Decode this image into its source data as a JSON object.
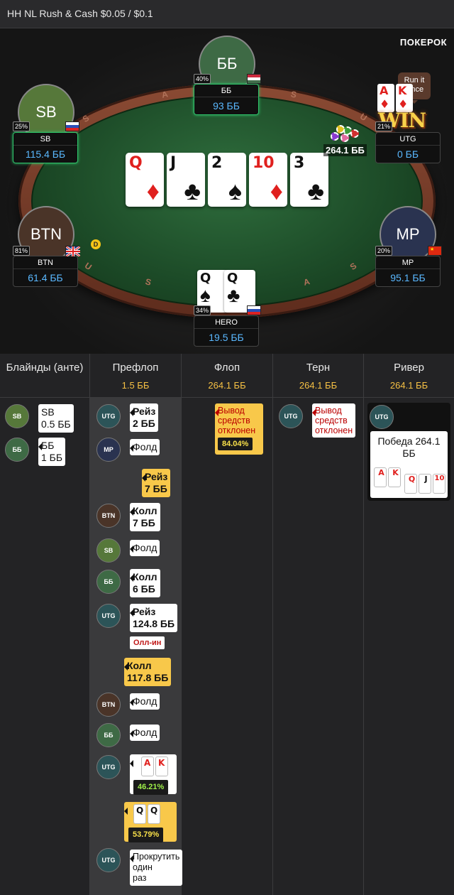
{
  "header": {
    "title": "HH NL Rush & Cash $0.05 / $0.1"
  },
  "brand": {
    "logo": "ПОКЕРОК",
    "run_it_once": "Run it Once"
  },
  "rail_letters": [
    "S",
    "A",
    "S",
    "U",
    "U",
    "S",
    "A",
    "S"
  ],
  "board": [
    {
      "rank": "Q",
      "suit": "♦",
      "color": "red"
    },
    {
      "rank": "J",
      "suit": "♣",
      "color": "black"
    },
    {
      "rank": "2",
      "suit": "♠",
      "color": "black"
    },
    {
      "rank": "10",
      "suit": "♦",
      "color": "red"
    },
    {
      "rank": "3",
      "suit": "♣",
      "color": "black"
    }
  ],
  "pot": "264.1 ББ",
  "dealer_button": "D",
  "win_text": "WIN",
  "seats": {
    "bb": {
      "avatar": "ББ",
      "name": "ББ",
      "stack": "93 ББ",
      "pct": "40%",
      "flag": "hungary",
      "avatar_color": "#3e6a45"
    },
    "sb": {
      "avatar": "SB",
      "name": "SB",
      "stack": "115.4 ББ",
      "pct": "25%",
      "flag": "russia",
      "avatar_color": "#56783a"
    },
    "utg": {
      "name": "UTG",
      "stack": "0 ББ",
      "pct": "21%",
      "cards": [
        {
          "rank": "A",
          "suit": "♦"
        },
        {
          "rank": "K",
          "suit": "♦"
        }
      ]
    },
    "btn": {
      "avatar": "BTN",
      "name": "BTN",
      "stack": "61.4 ББ",
      "pct": "81%",
      "flag": "uk",
      "avatar_color": "#4a3428"
    },
    "mp": {
      "avatar": "MP",
      "name": "MP",
      "stack": "95.1 ББ",
      "pct": "20%",
      "flag": "china",
      "avatar_color": "#2a3350"
    },
    "hero": {
      "name": "HERO",
      "stack": "19.5 ББ",
      "pct": "34%",
      "flag": "russia",
      "cards": [
        {
          "rank": "Q",
          "suit": "♠"
        },
        {
          "rank": "Q",
          "suit": "♣"
        }
      ]
    }
  },
  "history": {
    "columns": [
      {
        "name": "Блайнды (анте)",
        "pot": ""
      },
      {
        "name": "Префлоп",
        "pot": "1.5 ББ"
      },
      {
        "name": "Флоп",
        "pot": "264.1 ББ"
      },
      {
        "name": "Терн",
        "pot": "264.1 ББ"
      },
      {
        "name": "Ривер",
        "pot": "264.1 ББ"
      }
    ],
    "blinds": [
      {
        "pos": "SB",
        "line1": "SB",
        "line2": "0.5 ББ"
      },
      {
        "pos": "ББ",
        "line1": "ББ",
        "line2": "1 ББ"
      }
    ],
    "preflop": [
      {
        "pos": "UTG",
        "line1": "Рейз",
        "line2": "2 ББ"
      },
      {
        "pos": "MP",
        "line1": "Фолд"
      },
      {
        "pos": "HERO",
        "line1": "Рейз",
        "line2": "7 ББ"
      },
      {
        "pos": "BTN",
        "line1": "Колл",
        "line2": "7 ББ"
      },
      {
        "pos": "SB",
        "line1": "Фолд"
      },
      {
        "pos": "ББ",
        "line1": "Колл",
        "line2": "6 ББ"
      },
      {
        "pos": "UTG",
        "line1": "Рейз",
        "line2": "124.8 ББ",
        "tag": "Олл-ин"
      },
      {
        "pos": "HERO",
        "line1": "Колл",
        "line2": "117.8 ББ"
      },
      {
        "pos": "BTN",
        "line1": "Фолд"
      },
      {
        "pos": "ББ",
        "line1": "Фолд"
      },
      {
        "pos": "UTG",
        "cards": [
          "A",
          "K"
        ],
        "equity": "46.21%"
      },
      {
        "pos": "HERO",
        "cards": [
          "Q",
          "Q"
        ],
        "equity": "53.79%"
      },
      {
        "pos": "UTG",
        "line1": "Прокрутить",
        "line2": "один",
        "line3": "раз"
      }
    ],
    "flop": {
      "text1": "Вывод",
      "text2": "средств",
      "text3": "отклонен",
      "equity": "84.04%"
    },
    "turn": {
      "pos": "UTG",
      "text1": "Вывод",
      "text2": "средств",
      "text3": "отклонен"
    },
    "river": {
      "pos": "UTG",
      "win_line1": "Победа 264.1",
      "win_line2": "ББ",
      "cards": [
        {
          "rank": "A",
          "suit": "♦"
        },
        {
          "rank": "K",
          "suit": "♦"
        },
        {
          "rank": "Q",
          "suit": "♦"
        },
        {
          "rank": "J",
          "suit": "♣"
        },
        {
          "rank": "10",
          "suit": "♦"
        }
      ]
    }
  }
}
